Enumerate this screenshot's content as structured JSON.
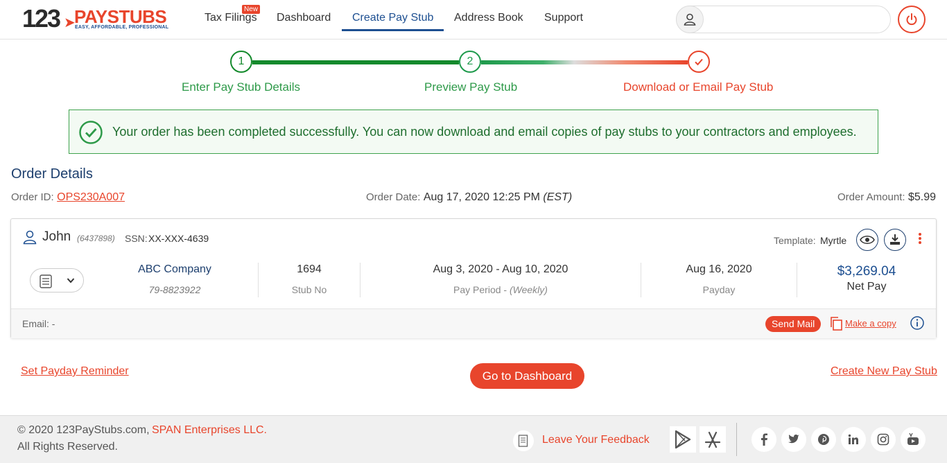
{
  "header": {
    "logo": {
      "num": "123",
      "name_a": "PAY",
      "name_b": "STUBS",
      "tagline": "EASY, AFFORDABLE, PROFESSIONAL"
    },
    "nav": [
      {
        "label": "Tax Filings",
        "badge": "New"
      },
      {
        "label": "Dashboard"
      },
      {
        "label": "Create Pay Stub",
        "active": true
      },
      {
        "label": "Address Book"
      },
      {
        "label": "Support"
      }
    ]
  },
  "steps": [
    {
      "num": "1",
      "label": "Enter Pay Stub Details"
    },
    {
      "num": "2",
      "label": "Preview Pay Stub"
    },
    {
      "label": "Download or Email Pay Stub"
    }
  ],
  "banner": {
    "message": "Your order has been completed successfully. You can now download and email copies of pay stubs to your contractors and employees."
  },
  "order": {
    "title": "Order Details",
    "id_label": "Order ID:",
    "id": "OPS230A007",
    "date_label": "Order Date:",
    "date": "Aug 17, 2020 12:25 PM",
    "timezone": "(EST)",
    "amount_label": "Order Amount:",
    "amount": "$5.99"
  },
  "stub": {
    "employee_name": "John",
    "employee_id": "(6437898)",
    "ssn_label": "SSN:",
    "ssn": "XX-XXX-4639",
    "template_label": "Template:",
    "template": "Myrtle",
    "company": "ABC Company",
    "company_ein": "79-8823922",
    "stub_no": "1694",
    "stub_no_label": "Stub No",
    "pay_period": "Aug 3, 2020 - Aug 10, 2020",
    "pay_period_label": "Pay Period - ",
    "pay_frequency": "(Weekly)",
    "payday": "Aug 16, 2020",
    "payday_label": "Payday",
    "net_pay": "$3,269.04",
    "net_pay_label": "Net Pay",
    "email_label": "Email: -",
    "send_mail": "Send Mail",
    "make_copy": "Make a copy"
  },
  "actions": {
    "reminder": "Set Payday Reminder",
    "dashboard": "Go to Dashboard",
    "new_stub": "Create New Pay Stub"
  },
  "footer": {
    "copyright": "© 2020 123PayStubs.com,",
    "company": "SPAN Enterprises LLC.",
    "rights": "All Rights Reserved.",
    "feedback": "Leave Your Feedback"
  },
  "colors": {
    "brand_red": "#e8452c",
    "brand_blue": "#1d4f91",
    "success_green": "#3fa34d"
  }
}
